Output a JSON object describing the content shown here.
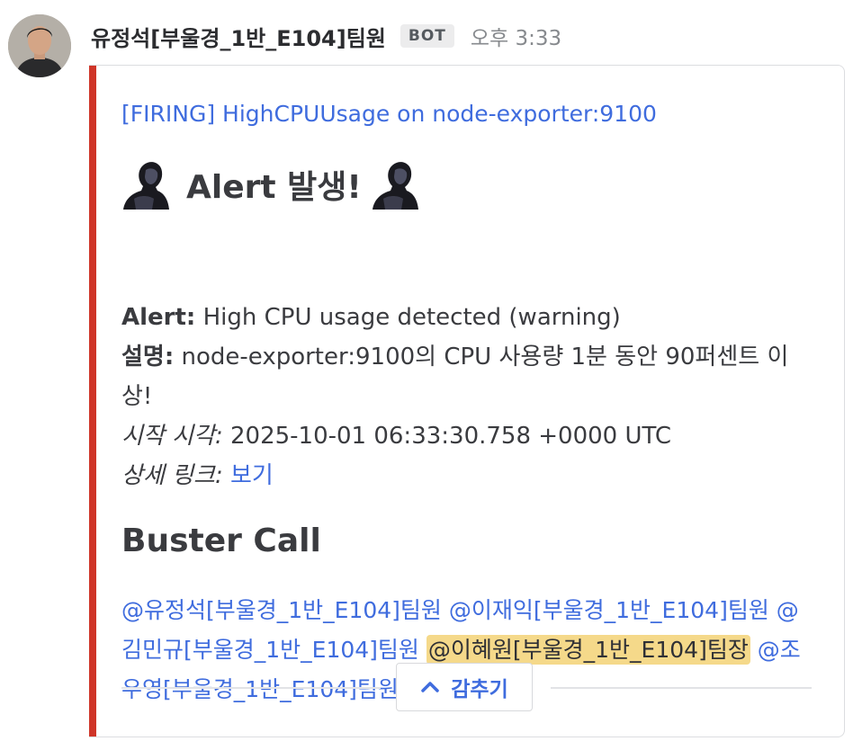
{
  "message": {
    "author": "유정석[부울경_1반_E104]팀원",
    "badge": "BOT",
    "time": "오후 3:33"
  },
  "alert": {
    "accent_color": "#cf3528",
    "title_link": "[FIRING] HighCPUUsage on node-exporter:9100",
    "heading": "Alert 발생!",
    "heading_icons": [
      "figure-icon",
      "figure-icon"
    ],
    "alert_label": "Alert:",
    "alert_value": "High CPU usage detected (warning)",
    "desc_label": "설명:",
    "desc_value": "node-exporter:9100의 CPU 사용량 1분 동안 90퍼센트 이상!",
    "start_label": "시작 시각:",
    "start_value": "2025-10-01 06:33:30.758 +0000 UTC",
    "link_label": "상세 링크:",
    "link_text": "보기"
  },
  "section": {
    "heading": "Buster Call",
    "mentions": [
      {
        "text": "@유정석[부울경_1반_E104]팀원",
        "highlight": false
      },
      {
        "text": "@이재익[부울경_1반_E104]팀원",
        "highlight": false
      },
      {
        "text": "@김민규[부울경_1반_E104]팀원",
        "highlight": false
      },
      {
        "text": "@이혜원[부울경_1반_E104]팀장",
        "highlight": true
      },
      {
        "text": "@조우영[부울경_1반_E104]팀원",
        "highlight": false
      }
    ]
  },
  "collapse": {
    "label": "감추기",
    "icon": "chevron-up-icon"
  }
}
